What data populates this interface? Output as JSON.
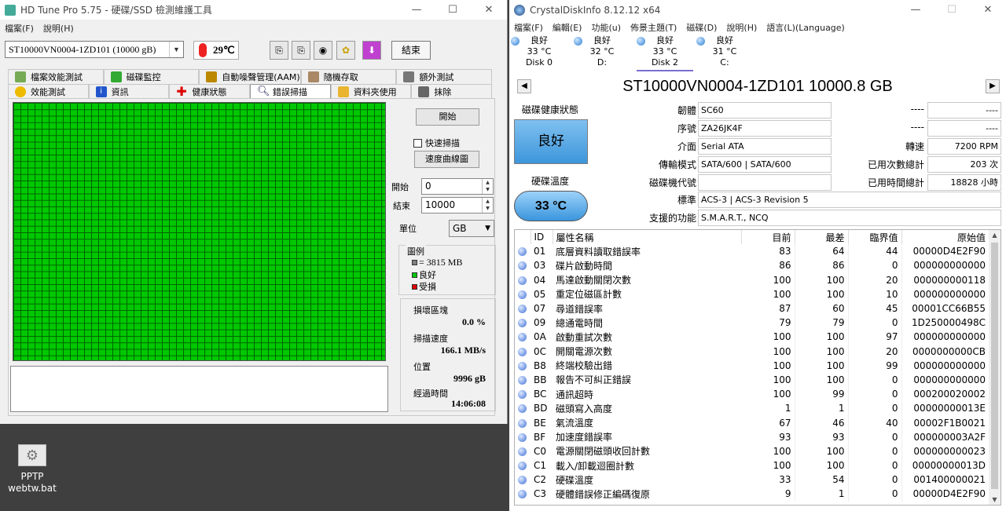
{
  "hdtune": {
    "title": "HD Tune Pro 5.75 - 硬碟/SSD 檢測維護工具",
    "menu": [
      "檔案(F)",
      "說明(H)"
    ],
    "drive": "ST10000VN0004-1ZD101 (10000 gB)",
    "temperature": "29℃",
    "exit": "結束",
    "tabs_row1": [
      "檔案效能測試",
      "磁碟監控",
      "自動噪聲管理(AAM)",
      "隨機存取",
      "額外測試"
    ],
    "tabs_row2": [
      "效能測試",
      "資訊",
      "健康狀態",
      "錯誤掃描",
      "資料夾使用",
      "抹除"
    ],
    "active_tab": "錯誤掃描",
    "start_button": "開始",
    "quick_scan": "快速掃描",
    "speed_curve": "速度曲線圖",
    "start_label": "開始",
    "start_value": "0",
    "end_label": "結束",
    "end_value": "10000",
    "unit_label": "單位",
    "unit_value": "GB",
    "legend_title": "圖例",
    "legend_block": "= 3815 MB",
    "legend_good": "良好",
    "legend_bad": "受損",
    "damaged_label": "損壞區塊",
    "damaged_value": "0.0 %",
    "speed_label": "掃描速度",
    "speed_value": "166.1 MB/s",
    "position_label": "位置",
    "position_value": "9996 gB",
    "elapsed_label": "經過時間",
    "elapsed_value": "14:06:08",
    "colors": {
      "good": "#00c800",
      "bad": "#e00000",
      "block": "#808080"
    }
  },
  "desktop": {
    "icon_label_1": "PPTP",
    "icon_label_2": "webtw.bat"
  },
  "cdi": {
    "title": "CrystalDiskInfo 8.12.12 x64",
    "menu": [
      "檔案(F)",
      "編輯(E)",
      "功能(u)",
      "佈景主題(T)",
      "磁碟(D)",
      "說明(H)",
      "語言(L)(Language)"
    ],
    "disks": [
      {
        "status": "良好",
        "temp": "33 °C",
        "name": "Disk 0"
      },
      {
        "status": "良好",
        "temp": "32 °C",
        "name": "D:"
      },
      {
        "status": "良好",
        "temp": "33 °C",
        "name": "Disk 2"
      },
      {
        "status": "良好",
        "temp": "31 °C",
        "name": "C:"
      }
    ],
    "drive_title": "ST10000VN0004-1ZD101 10000.8 GB",
    "health_label": "磁碟健康狀態",
    "health_value": "良好",
    "temp_label": "硬碟溫度",
    "temp_value": "33 °C",
    "firmware_label": "韌體",
    "firmware": "SC60",
    "serial_label": "序號",
    "serial": "ZA26JK4F",
    "interface_label": "介面",
    "interface": "Serial ATA",
    "transfer_label": "傳輸模式",
    "transfer": "SATA/600 | SATA/600",
    "letter_label": "磁碟機代號",
    "letter": "",
    "standard_label": "標準",
    "standard": "ACS-3 | ACS-3 Revision 5",
    "features_label": "支援的功能",
    "features": "S.M.A.R.T., NCQ",
    "r1_label": "----",
    "r1": "----",
    "r2_label": "----",
    "r2": "----",
    "rpm_label": "轉速",
    "rpm": "7200 RPM",
    "poc_label": "已用次數總計",
    "poc": "203 次",
    "poh_label": "已用時間總計",
    "poh": "18828 小時",
    "smart_headers": [
      "ID",
      "屬性名稱",
      "目前",
      "最差",
      "臨界值",
      "原始值"
    ],
    "smart_rows": [
      [
        "01",
        "底層資料讀取錯誤率",
        "83",
        "64",
        "44",
        "00000D4E2F90"
      ],
      [
        "03",
        "碟片啟動時間",
        "86",
        "86",
        "0",
        "000000000000"
      ],
      [
        "04",
        "馬達啟動關閉次數",
        "100",
        "100",
        "20",
        "000000000118"
      ],
      [
        "05",
        "重定位磁區計數",
        "100",
        "100",
        "10",
        "000000000000"
      ],
      [
        "07",
        "尋道錯誤率",
        "87",
        "60",
        "45",
        "00001CC66B55"
      ],
      [
        "09",
        "總通電時間",
        "79",
        "79",
        "0",
        "1D250000498C"
      ],
      [
        "0A",
        "啟動重試次數",
        "100",
        "100",
        "97",
        "000000000000"
      ],
      [
        "0C",
        "開關電源次數",
        "100",
        "100",
        "20",
        "0000000000CB"
      ],
      [
        "B8",
        "終端校驗出錯",
        "100",
        "100",
        "99",
        "000000000000"
      ],
      [
        "BB",
        "報告不可糾正錯誤",
        "100",
        "100",
        "0",
        "000000000000"
      ],
      [
        "BC",
        "通訊超時",
        "100",
        "99",
        "0",
        "000200020002"
      ],
      [
        "BD",
        "磁頭寫入高度",
        "1",
        "1",
        "0",
        "00000000013E"
      ],
      [
        "BE",
        "氣流溫度",
        "67",
        "46",
        "40",
        "00002F1B0021"
      ],
      [
        "BF",
        "加速度錯誤率",
        "93",
        "93",
        "0",
        "000000003A2F"
      ],
      [
        "C0",
        "電源關閉磁頭收回計數",
        "100",
        "100",
        "0",
        "000000000023"
      ],
      [
        "C1",
        "載入/卸載迴圈計數",
        "100",
        "100",
        "0",
        "00000000013D"
      ],
      [
        "C2",
        "硬碟溫度",
        "33",
        "54",
        "0",
        "001400000021"
      ],
      [
        "C3",
        "硬體錯誤修正編碼復原",
        "9",
        "1",
        "0",
        "00000D4E2F90"
      ]
    ]
  }
}
